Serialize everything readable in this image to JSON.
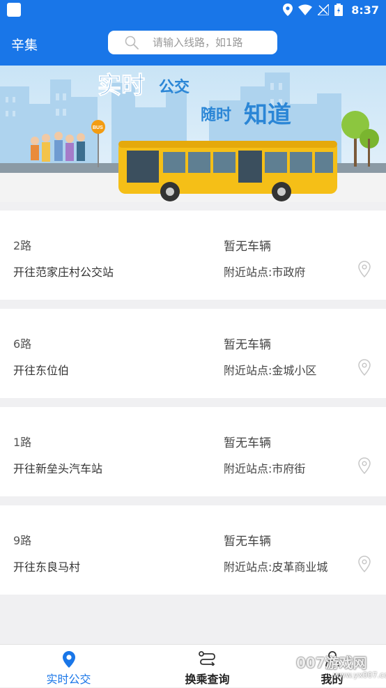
{
  "status_bar": {
    "time": "8:37"
  },
  "header": {
    "city": "辛集",
    "search_placeholder": "请输入线路，如1路"
  },
  "banner": {
    "title_line1_big": "实时",
    "title_line1_small": "公交",
    "title_line2_small": "随时",
    "title_line2_big": "知道",
    "bus_stop_sign": "BUS"
  },
  "routes": [
    {
      "name": "2路",
      "destination": "开往范家庄村公交站",
      "status": "暂无车辆",
      "nearby_stop": "附近站点:市政府"
    },
    {
      "name": "6路",
      "destination": "开往东位伯",
      "status": "暂无车辆",
      "nearby_stop": "附近站点:金城小区"
    },
    {
      "name": "1路",
      "destination": "开往新垒头汽车站",
      "status": "暂无车辆",
      "nearby_stop": "附近站点:市府街"
    },
    {
      "name": "9路",
      "destination": "开往东良马村",
      "status": "暂无车辆",
      "nearby_stop": "附近站点:皮革商业城"
    }
  ],
  "tabs": [
    {
      "label": "实时公交",
      "icon": "location-pin-icon",
      "active": true
    },
    {
      "label": "换乘查询",
      "icon": "transfer-route-icon",
      "active": false
    },
    {
      "label": "我的",
      "icon": "user-icon",
      "active": false
    }
  ],
  "watermark": {
    "text": "007游戏网",
    "url": "www.yx007.com"
  },
  "colors": {
    "primary": "#1976e8",
    "active_tab": "#1976e8",
    "background": "#f0f0f2"
  }
}
